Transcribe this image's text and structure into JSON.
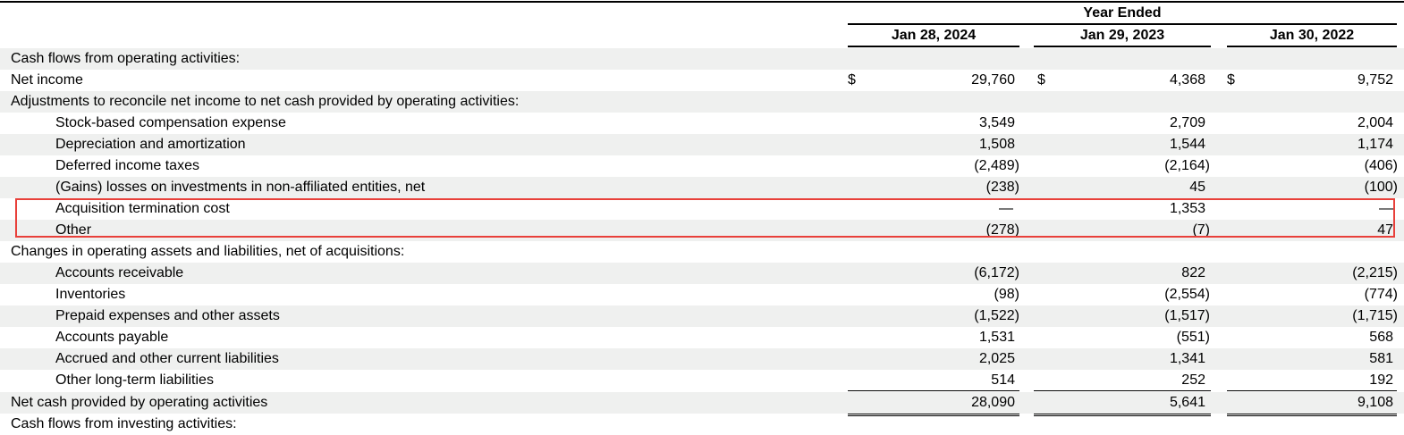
{
  "header": {
    "group_label": "Year Ended",
    "columns": [
      "Jan 28, 2024",
      "Jan 29, 2023",
      "Jan 30, 2022"
    ]
  },
  "rows": [
    {
      "label": "Cash flows from operating activities:",
      "values": [
        "",
        "",
        ""
      ]
    },
    {
      "label": "Net income",
      "dollar": "$",
      "values": [
        "29,760",
        "4,368",
        "9,752"
      ]
    },
    {
      "label": "Adjustments to reconcile net income to net cash provided by operating activities:",
      "values": [
        "",
        "",
        ""
      ]
    },
    {
      "label": "Stock-based compensation expense",
      "values": [
        "3,549",
        "2,709",
        "2,004"
      ]
    },
    {
      "label": "Depreciation and amortization",
      "values": [
        "1,508",
        "1,544",
        "1,174"
      ]
    },
    {
      "label": "Deferred income taxes",
      "values": [
        "(2,489)",
        "(2,164)",
        "(406)"
      ]
    },
    {
      "label": "(Gains) losses on investments in non-affiliated entities, net",
      "values": [
        "(238)",
        "45",
        "(100)"
      ]
    },
    {
      "label": "Acquisition termination cost",
      "values": [
        "—",
        "1,353",
        "—"
      ]
    },
    {
      "label": "Other",
      "values": [
        "(278)",
        "(7)",
        "47"
      ]
    },
    {
      "label": "Changes in operating assets and liabilities, net of acquisitions:",
      "values": [
        "",
        "",
        ""
      ]
    },
    {
      "label": "Accounts receivable",
      "values": [
        "(6,172)",
        "822",
        "(2,215)"
      ]
    },
    {
      "label": "Inventories",
      "values": [
        "(98)",
        "(2,554)",
        "(774)"
      ]
    },
    {
      "label": "Prepaid expenses and other assets",
      "values": [
        "(1,522)",
        "(1,517)",
        "(1,715)"
      ]
    },
    {
      "label": "Accounts payable",
      "values": [
        "1,531",
        "(551)",
        "568"
      ]
    },
    {
      "label": "Accrued and other current liabilities",
      "values": [
        "2,025",
        "1,341",
        "581"
      ]
    },
    {
      "label": "Other long-term liabilities",
      "values": [
        "514",
        "252",
        "192"
      ]
    },
    {
      "label": "Net cash provided by operating activities",
      "values": [
        "28,090",
        "5,641",
        "9,108"
      ]
    }
  ],
  "cut_off_row": "Cash flows from investing activities:",
  "highlight_color": "#e8403a",
  "row_shade_color": "#eff0ef"
}
